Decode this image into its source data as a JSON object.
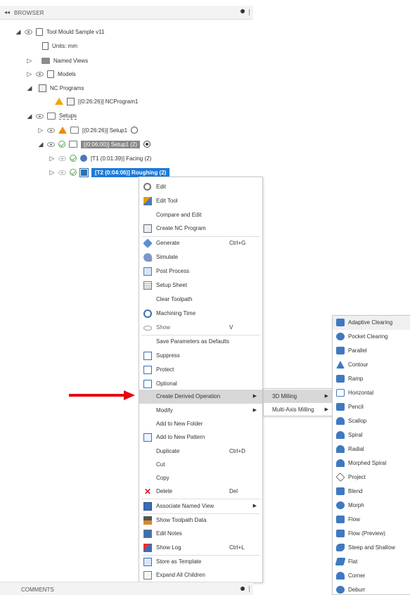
{
  "browser": {
    "collapse_glyph": "◂◂",
    "title": "BROWSER"
  },
  "tree": {
    "root_label": "Tool Mould Sample v11",
    "units_label": "Units: mm",
    "named_views_label": "Named Views",
    "models_label": "Models",
    "nc_programs_label": "NC Programs",
    "ncprogram1_label": "[(0:26:26)] NCProgram1",
    "setups_label": "Setups",
    "setup1_label": "[(0:26:26)] Setup1",
    "setup1_2_label": "[(0:06:00)] Setup1 (2)",
    "facing_label": "[T1 (0:01:39)] Facing (2)",
    "roughing_label": "[T2 (0:04:06)] Roughing (2)"
  },
  "context_menu": {
    "items": [
      {
        "label": "Edit",
        "icon": "gear-icon"
      },
      {
        "label": "Edit Tool",
        "icon": "tool-icon"
      },
      {
        "label": "Compare and Edit",
        "icon": ""
      },
      {
        "label": "Create NC Program",
        "icon": "nc-program-icon"
      },
      {
        "label": "Generate",
        "icon": "generate-icon",
        "shortcut": "Ctrl+G"
      },
      {
        "label": "Simulate",
        "icon": "simulate-icon"
      },
      {
        "label": "Post Process",
        "icon": "post-process-icon"
      },
      {
        "label": "Setup Sheet",
        "icon": "setup-sheet-icon"
      },
      {
        "label": "Clear Toolpath",
        "icon": ""
      },
      {
        "label": "Machining Time",
        "icon": "clock-icon"
      },
      {
        "label": "Show",
        "icon": "eye-icon",
        "shortcut": "V"
      },
      {
        "label": "Save Parameters as Defaults",
        "icon": ""
      },
      {
        "label": "Suppress",
        "icon": "checkbox-icon"
      },
      {
        "label": "Protect",
        "icon": "checkbox-icon"
      },
      {
        "label": "Optional",
        "icon": "checkbox-icon"
      },
      {
        "label": "Create Derived Operation",
        "icon": "",
        "submenu": true
      },
      {
        "label": "Modify",
        "icon": "",
        "submenu": true
      },
      {
        "label": "Add to New Folder",
        "icon": ""
      },
      {
        "label": "Add to New Pattern",
        "icon": "pattern-icon"
      },
      {
        "label": "Duplicate",
        "icon": "",
        "shortcut": "Ctrl+D"
      },
      {
        "label": "Cut",
        "icon": ""
      },
      {
        "label": "Copy",
        "icon": ""
      },
      {
        "label": "Delete",
        "icon": "delete-icon",
        "shortcut": "Del"
      },
      {
        "label": "Associate Named View",
        "icon": "named-view-icon",
        "submenu": true
      },
      {
        "label": "Show Toolpath Data",
        "icon": "toolpath-data-icon"
      },
      {
        "label": "Edit Notes",
        "icon": "notes-icon"
      },
      {
        "label": "Show Log",
        "icon": "log-icon",
        "shortcut": "Ctrl+L"
      },
      {
        "label": "Store as Template",
        "icon": "template-icon"
      },
      {
        "label": "Expand All Children",
        "icon": "expand-icon"
      }
    ]
  },
  "submenu_derived": {
    "items": [
      {
        "label": "3D Milling"
      },
      {
        "label": "Multi-Axis Milling"
      }
    ]
  },
  "submenu_3d_milling": {
    "items": [
      {
        "label": "Adaptive Clearing"
      },
      {
        "label": "Pocket Clearing"
      },
      {
        "label": "Parallel"
      },
      {
        "label": "Contour"
      },
      {
        "label": "Ramp"
      },
      {
        "label": "Horizontal"
      },
      {
        "label": "Pencil"
      },
      {
        "label": "Scallop"
      },
      {
        "label": "Spiral"
      },
      {
        "label": "Radial"
      },
      {
        "label": "Morphed Spiral"
      },
      {
        "label": "Project"
      },
      {
        "label": "Blend"
      },
      {
        "label": "Morph"
      },
      {
        "label": "Flow"
      },
      {
        "label": "Flow (Preview)"
      },
      {
        "label": "Steep and Shallow"
      },
      {
        "label": "Flat"
      },
      {
        "label": "Corner"
      },
      {
        "label": "Deburr"
      }
    ]
  },
  "comments": {
    "title": "COMMENTS"
  },
  "colors": {
    "selection_blue": "#1a7ad9",
    "hover_grey": "#d7d7d7",
    "annotation_red": "#e30613",
    "warning_orange": "#f2a400"
  }
}
